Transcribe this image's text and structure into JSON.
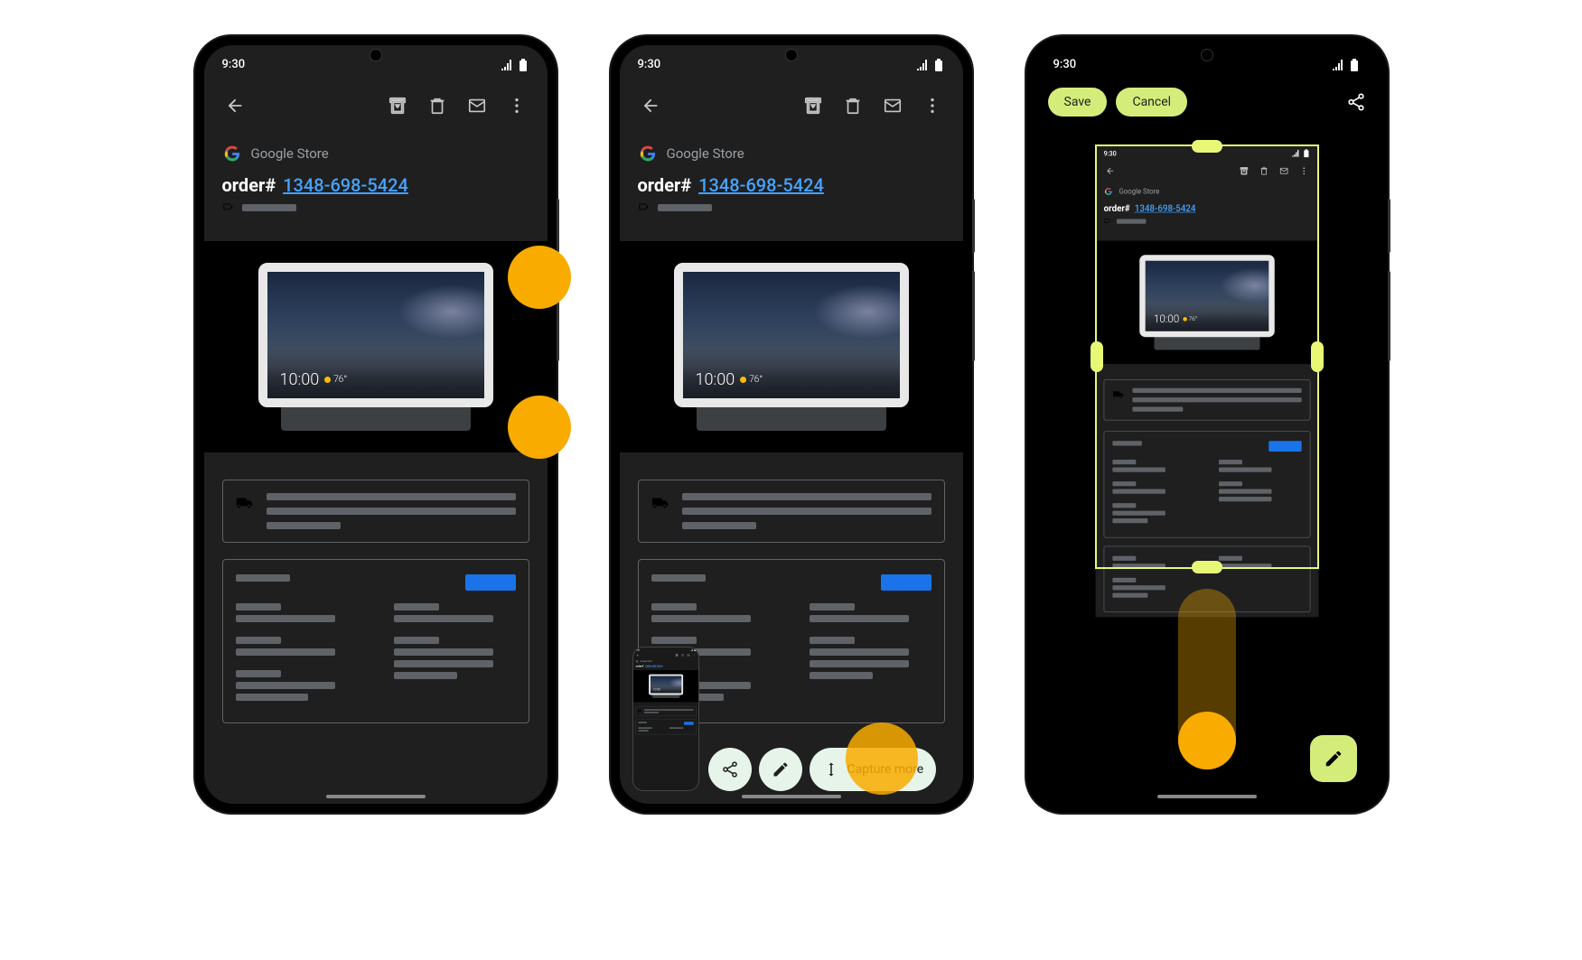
{
  "status": {
    "time": "9:30"
  },
  "app": {
    "sender": "Google Store",
    "order_prefix": "order#",
    "order_number": "1348-698-5424"
  },
  "product": {
    "clock_time": "10:00",
    "temp": "76°"
  },
  "shot": {
    "capture_more": "Capture more"
  },
  "crop": {
    "save": "Save",
    "cancel": "Cancel"
  }
}
